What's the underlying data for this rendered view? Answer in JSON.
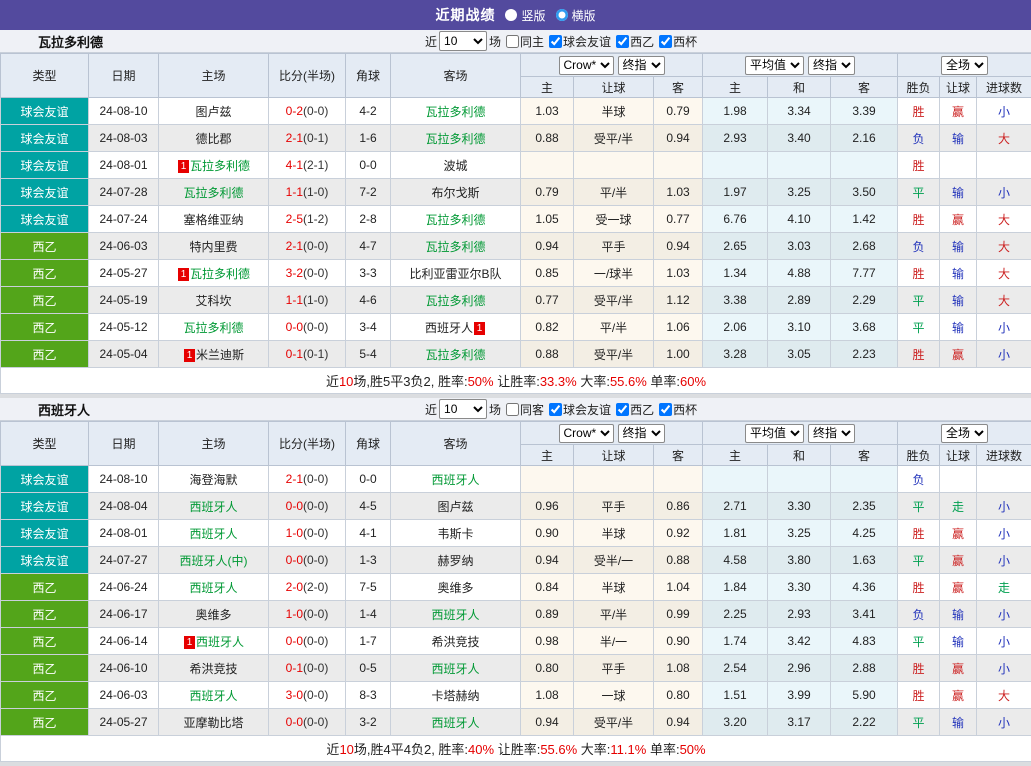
{
  "topbar": {
    "title": "近期战绩",
    "options": [
      {
        "label": "竖版",
        "selected": false
      },
      {
        "label": "横版",
        "selected": true
      }
    ]
  },
  "palette": {
    "accent_purple": "#534A9E",
    "types": {
      "friendly": "#00A3A3",
      "league": "#53A51A"
    },
    "results": {
      "r": "#CC2222",
      "b": "#2233BB",
      "g": "#00A050"
    },
    "team_highlight_green": "#009934",
    "score_red": "#E60000"
  },
  "sections": [
    {
      "team": "瓦拉多利德",
      "filter": {
        "prefix": "近",
        "count": "10",
        "suffix": "场",
        "same_venue": {
          "label": "同主",
          "checked": false
        },
        "leagues": [
          {
            "label": "球会友谊",
            "checked": true
          },
          {
            "label": "西乙",
            "checked": true
          },
          {
            "label": "西杯",
            "checked": true
          }
        ]
      },
      "columns": [
        "类型",
        "日期",
        "主场",
        "比分(半场)",
        "角球",
        "客场"
      ],
      "dropdowns": {
        "book": "Crow*",
        "book_stage": "终指",
        "avg": "平均值",
        "avg_stage": "终指",
        "scope": "全场"
      },
      "sub_columns": [
        "主",
        "让球",
        "客",
        "主",
        "和",
        "客",
        "胜负",
        "让球",
        "进球数"
      ],
      "rows": [
        {
          "type": "球会友谊",
          "type_key": "friendly",
          "date": "24-08-10",
          "home": {
            "name": "图卢兹"
          },
          "score": "0-2",
          "half": "(0-0)",
          "corner": "4-2",
          "away": {
            "name": "瓦拉多利德",
            "green": true
          },
          "hcap": [
            "1.03",
            "半球",
            "0.79"
          ],
          "avg": [
            "1.98",
            "3.34",
            "3.39"
          ],
          "result": [
            [
              "胜",
              "r"
            ],
            [
              "赢",
              "r"
            ],
            [
              "小",
              "b"
            ]
          ]
        },
        {
          "type": "球会友谊",
          "type_key": "friendly",
          "date": "24-08-03",
          "home": {
            "name": "德比郡"
          },
          "score": "2-1",
          "half": "(0-1)",
          "corner": "1-6",
          "away": {
            "name": "瓦拉多利德",
            "green": true
          },
          "hcap": [
            "0.88",
            "受平/半",
            "0.94"
          ],
          "avg": [
            "2.93",
            "3.40",
            "2.16"
          ],
          "result": [
            [
              "负",
              "b"
            ],
            [
              "输",
              "b"
            ],
            [
              "大",
              "r"
            ]
          ]
        },
        {
          "type": "球会友谊",
          "type_key": "friendly",
          "date": "24-08-01",
          "home": {
            "name": "瓦拉多利德",
            "green": true,
            "badge": "1",
            "badge_pos": "before"
          },
          "score": "4-1",
          "half": "(2-1)",
          "corner": "0-0",
          "away": {
            "name": "波城"
          },
          "hcap": [
            "",
            "",
            ""
          ],
          "avg": [
            "",
            "",
            ""
          ],
          "result": [
            [
              "胜",
              "r"
            ],
            [
              "",
              ""
            ],
            [
              "",
              ""
            ]
          ]
        },
        {
          "type": "球会友谊",
          "type_key": "friendly",
          "date": "24-07-28",
          "home": {
            "name": "瓦拉多利德",
            "green": true
          },
          "score": "1-1",
          "half": "(1-0)",
          "corner": "7-2",
          "away": {
            "name": "布尔戈斯"
          },
          "hcap": [
            "0.79",
            "平/半",
            "1.03"
          ],
          "avg": [
            "1.97",
            "3.25",
            "3.50"
          ],
          "result": [
            [
              "平",
              "g"
            ],
            [
              "输",
              "b"
            ],
            [
              "小",
              "b"
            ]
          ]
        },
        {
          "type": "球会友谊",
          "type_key": "friendly",
          "date": "24-07-24",
          "home": {
            "name": "塞格维亚纳"
          },
          "score": "2-5",
          "half": "(1-2)",
          "corner": "2-8",
          "away": {
            "name": "瓦拉多利德",
            "green": true
          },
          "hcap": [
            "1.05",
            "受一球",
            "0.77"
          ],
          "avg": [
            "6.76",
            "4.10",
            "1.42"
          ],
          "result": [
            [
              "胜",
              "r"
            ],
            [
              "赢",
              "r"
            ],
            [
              "大",
              "r"
            ]
          ]
        },
        {
          "type": "西乙",
          "type_key": "league",
          "date": "24-06-03",
          "home": {
            "name": "特内里费"
          },
          "score": "2-1",
          "half": "(0-0)",
          "corner": "4-7",
          "away": {
            "name": "瓦拉多利德",
            "green": true
          },
          "hcap": [
            "0.94",
            "平手",
            "0.94"
          ],
          "avg": [
            "2.65",
            "3.03",
            "2.68"
          ],
          "result": [
            [
              "负",
              "b"
            ],
            [
              "输",
              "b"
            ],
            [
              "大",
              "r"
            ]
          ]
        },
        {
          "type": "西乙",
          "type_key": "league",
          "date": "24-05-27",
          "home": {
            "name": "瓦拉多利德",
            "green": true,
            "badge": "1",
            "badge_pos": "before"
          },
          "score": "3-2",
          "half": "(0-0)",
          "corner": "3-3",
          "away": {
            "name": "比利亚雷亚尔B队"
          },
          "hcap": [
            "0.85",
            "一/球半",
            "1.03"
          ],
          "avg": [
            "1.34",
            "4.88",
            "7.77"
          ],
          "result": [
            [
              "胜",
              "r"
            ],
            [
              "输",
              "b"
            ],
            [
              "大",
              "r"
            ]
          ]
        },
        {
          "type": "西乙",
          "type_key": "league",
          "date": "24-05-19",
          "home": {
            "name": "艾科坎"
          },
          "score": "1-1",
          "half": "(1-0)",
          "corner": "4-6",
          "away": {
            "name": "瓦拉多利德",
            "green": true
          },
          "hcap": [
            "0.77",
            "受平/半",
            "1.12"
          ],
          "avg": [
            "3.38",
            "2.89",
            "2.29"
          ],
          "result": [
            [
              "平",
              "g"
            ],
            [
              "输",
              "b"
            ],
            [
              "大",
              "r"
            ]
          ]
        },
        {
          "type": "西乙",
          "type_key": "league",
          "date": "24-05-12",
          "home": {
            "name": "瓦拉多利德",
            "green": true
          },
          "score": "0-0",
          "half": "(0-0)",
          "corner": "3-4",
          "away": {
            "name": "西班牙人",
            "badge": "1",
            "badge_pos": "after"
          },
          "hcap": [
            "0.82",
            "平/半",
            "1.06"
          ],
          "avg": [
            "2.06",
            "3.10",
            "3.68"
          ],
          "result": [
            [
              "平",
              "g"
            ],
            [
              "输",
              "b"
            ],
            [
              "小",
              "b"
            ]
          ]
        },
        {
          "type": "西乙",
          "type_key": "league",
          "date": "24-05-04",
          "home": {
            "name": "米兰迪斯",
            "badge": "1",
            "badge_pos": "before"
          },
          "score": "0-1",
          "half": "(0-1)",
          "corner": "5-4",
          "away": {
            "name": "瓦拉多利德",
            "green": true
          },
          "hcap": [
            "0.88",
            "受平/半",
            "1.00"
          ],
          "avg": [
            "3.28",
            "3.05",
            "2.23"
          ],
          "result": [
            [
              "胜",
              "r"
            ],
            [
              "赢",
              "r"
            ],
            [
              "小",
              "b"
            ]
          ]
        }
      ],
      "summary": [
        [
          "近",
          0
        ],
        [
          "10",
          1
        ],
        [
          "场,胜5平3负2, 胜率:",
          0
        ],
        [
          "50%",
          1
        ],
        [
          " 让胜率:",
          0
        ],
        [
          "33.3%",
          1
        ],
        [
          " 大率:",
          0
        ],
        [
          "55.6%",
          1
        ],
        [
          " 单率:",
          0
        ],
        [
          "60%",
          1
        ]
      ]
    },
    {
      "team": "西班牙人",
      "filter": {
        "prefix": "近",
        "count": "10",
        "suffix": "场",
        "same_venue": {
          "label": "同客",
          "checked": false
        },
        "leagues": [
          {
            "label": "球会友谊",
            "checked": true
          },
          {
            "label": "西乙",
            "checked": true
          },
          {
            "label": "西杯",
            "checked": true
          }
        ]
      },
      "columns": [
        "类型",
        "日期",
        "主场",
        "比分(半场)",
        "角球",
        "客场"
      ],
      "dropdowns": {
        "book": "Crow*",
        "book_stage": "终指",
        "avg": "平均值",
        "avg_stage": "终指",
        "scope": "全场"
      },
      "sub_columns": [
        "主",
        "让球",
        "客",
        "主",
        "和",
        "客",
        "胜负",
        "让球",
        "进球数"
      ],
      "rows": [
        {
          "type": "球会友谊",
          "type_key": "friendly",
          "date": "24-08-10",
          "home": {
            "name": "海登海默"
          },
          "score": "2-1",
          "half": "(0-0)",
          "corner": "0-0",
          "away": {
            "name": "西班牙人",
            "green": true
          },
          "hcap": [
            "",
            "",
            ""
          ],
          "avg": [
            "",
            "",
            ""
          ],
          "result": [
            [
              "负",
              "b"
            ],
            [
              "",
              ""
            ],
            [
              "",
              ""
            ]
          ]
        },
        {
          "type": "球会友谊",
          "type_key": "friendly",
          "date": "24-08-04",
          "home": {
            "name": "西班牙人",
            "green": true
          },
          "score": "0-0",
          "half": "(0-0)",
          "corner": "4-5",
          "away": {
            "name": "图卢兹"
          },
          "hcap": [
            "0.96",
            "平手",
            "0.86"
          ],
          "avg": [
            "2.71",
            "3.30",
            "2.35"
          ],
          "result": [
            [
              "平",
              "g"
            ],
            [
              "走",
              "g"
            ],
            [
              "小",
              "b"
            ]
          ]
        },
        {
          "type": "球会友谊",
          "type_key": "friendly",
          "date": "24-08-01",
          "home": {
            "name": "西班牙人",
            "green": true
          },
          "score": "1-0",
          "half": "(0-0)",
          "corner": "4-1",
          "away": {
            "name": "韦斯卡"
          },
          "hcap": [
            "0.90",
            "半球",
            "0.92"
          ],
          "avg": [
            "1.81",
            "3.25",
            "4.25"
          ],
          "result": [
            [
              "胜",
              "r"
            ],
            [
              "赢",
              "r"
            ],
            [
              "小",
              "b"
            ]
          ]
        },
        {
          "type": "球会友谊",
          "type_key": "friendly",
          "date": "24-07-27",
          "home": {
            "name": "西班牙人(中)",
            "green": true
          },
          "score": "0-0",
          "half": "(0-0)",
          "corner": "1-3",
          "away": {
            "name": "赫罗纳"
          },
          "hcap": [
            "0.94",
            "受半/一",
            "0.88"
          ],
          "avg": [
            "4.58",
            "3.80",
            "1.63"
          ],
          "result": [
            [
              "平",
              "g"
            ],
            [
              "赢",
              "r"
            ],
            [
              "小",
              "b"
            ]
          ]
        },
        {
          "type": "西乙",
          "type_key": "league",
          "date": "24-06-24",
          "home": {
            "name": "西班牙人",
            "green": true
          },
          "score": "2-0",
          "half": "(2-0)",
          "corner": "7-5",
          "away": {
            "name": "奥维多"
          },
          "hcap": [
            "0.84",
            "半球",
            "1.04"
          ],
          "avg": [
            "1.84",
            "3.30",
            "4.36"
          ],
          "result": [
            [
              "胜",
              "r"
            ],
            [
              "赢",
              "r"
            ],
            [
              "走",
              "g"
            ]
          ]
        },
        {
          "type": "西乙",
          "type_key": "league",
          "date": "24-06-17",
          "home": {
            "name": "奥维多"
          },
          "score": "1-0",
          "half": "(0-0)",
          "corner": "1-4",
          "away": {
            "name": "西班牙人",
            "green": true
          },
          "hcap": [
            "0.89",
            "平/半",
            "0.99"
          ],
          "avg": [
            "2.25",
            "2.93",
            "3.41"
          ],
          "result": [
            [
              "负",
              "b"
            ],
            [
              "输",
              "b"
            ],
            [
              "小",
              "b"
            ]
          ]
        },
        {
          "type": "西乙",
          "type_key": "league",
          "date": "24-06-14",
          "home": {
            "name": "西班牙人",
            "green": true,
            "badge": "1",
            "badge_pos": "before"
          },
          "score": "0-0",
          "half": "(0-0)",
          "corner": "1-7",
          "away": {
            "name": "希洪竞技"
          },
          "hcap": [
            "0.98",
            "半/一",
            "0.90"
          ],
          "avg": [
            "1.74",
            "3.42",
            "4.83"
          ],
          "result": [
            [
              "平",
              "g"
            ],
            [
              "输",
              "b"
            ],
            [
              "小",
              "b"
            ]
          ]
        },
        {
          "type": "西乙",
          "type_key": "league",
          "date": "24-06-10",
          "home": {
            "name": "希洪竞技"
          },
          "score": "0-1",
          "half": "(0-0)",
          "corner": "0-5",
          "away": {
            "name": "西班牙人",
            "green": true
          },
          "hcap": [
            "0.80",
            "平手",
            "1.08"
          ],
          "avg": [
            "2.54",
            "2.96",
            "2.88"
          ],
          "result": [
            [
              "胜",
              "r"
            ],
            [
              "赢",
              "r"
            ],
            [
              "小",
              "b"
            ]
          ]
        },
        {
          "type": "西乙",
          "type_key": "league",
          "date": "24-06-03",
          "home": {
            "name": "西班牙人",
            "green": true
          },
          "score": "3-0",
          "half": "(0-0)",
          "corner": "8-3",
          "away": {
            "name": "卡塔赫纳"
          },
          "hcap": [
            "1.08",
            "一球",
            "0.80"
          ],
          "avg": [
            "1.51",
            "3.99",
            "5.90"
          ],
          "result": [
            [
              "胜",
              "r"
            ],
            [
              "赢",
              "r"
            ],
            [
              "大",
              "r"
            ]
          ]
        },
        {
          "type": "西乙",
          "type_key": "league",
          "date": "24-05-27",
          "home": {
            "name": "亚摩勒比塔"
          },
          "score": "0-0",
          "half": "(0-0)",
          "corner": "3-2",
          "away": {
            "name": "西班牙人",
            "green": true
          },
          "hcap": [
            "0.94",
            "受平/半",
            "0.94"
          ],
          "avg": [
            "3.20",
            "3.17",
            "2.22"
          ],
          "result": [
            [
              "平",
              "g"
            ],
            [
              "输",
              "b"
            ],
            [
              "小",
              "b"
            ]
          ]
        }
      ],
      "summary": [
        [
          "近",
          0
        ],
        [
          "10",
          1
        ],
        [
          "场,胜4平4负2, 胜率:",
          0
        ],
        [
          "40%",
          1
        ],
        [
          " 让胜率:",
          0
        ],
        [
          "55.6%",
          1
        ],
        [
          " 大率:",
          0
        ],
        [
          "11.1%",
          1
        ],
        [
          " 单率:",
          0
        ],
        [
          "50%",
          1
        ]
      ]
    }
  ]
}
